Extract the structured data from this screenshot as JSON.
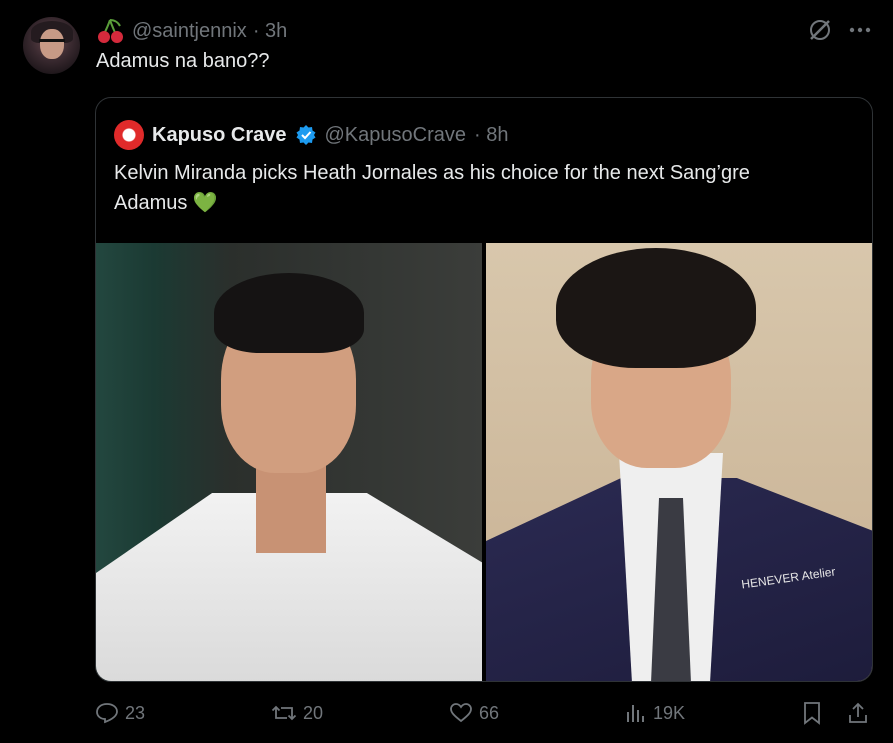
{
  "tweet": {
    "handle": "@saintjennix",
    "time": "· 3h",
    "text": "Adamus na bano??"
  },
  "quote": {
    "name": "Kapuso Crave",
    "handle": "@KapusoCrave",
    "time": "· 8h",
    "text_line1": "Kelvin Miranda picks Heath Jornales as his choice for the next Sang’gre",
    "text_line2": "Adamus 💚",
    "jacket_text": "HENEVER Atelier"
  },
  "actions": {
    "replies": "23",
    "reposts": "20",
    "likes": "66",
    "views": "19K"
  },
  "colors": {
    "text": "#e7e9ea",
    "muted": "#71767b",
    "verified": "#1d9bf0",
    "border": "#2f3336"
  }
}
